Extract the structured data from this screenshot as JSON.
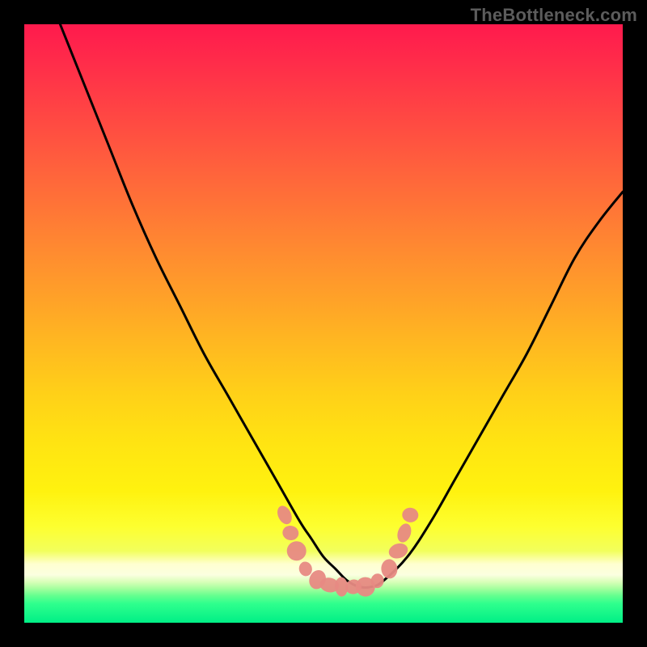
{
  "watermark": "TheBottleneck.com",
  "chart_data": {
    "type": "line",
    "title": "",
    "xlabel": "",
    "ylabel": "",
    "xlim": [
      0,
      100
    ],
    "ylim": [
      0,
      100
    ],
    "grid": false,
    "series": [
      {
        "name": "v-curve",
        "color": "#000000",
        "x": [
          6,
          10,
          14,
          18,
          22,
          26,
          30,
          34,
          38,
          42,
          46,
          48,
          50,
          52,
          54,
          56,
          58,
          60,
          64,
          68,
          72,
          76,
          80,
          84,
          88,
          92,
          96,
          100
        ],
        "y": [
          100,
          90,
          80,
          70,
          61,
          53,
          45,
          38,
          31,
          24,
          17,
          14,
          11,
          9,
          7,
          6,
          6,
          7,
          11,
          17,
          24,
          31,
          38,
          45,
          53,
          61,
          67,
          72
        ]
      }
    ],
    "markers": [
      {
        "name": "bottleneck-zone",
        "color": "#e78a83",
        "points": [
          {
            "x": 43.5,
            "y": 18
          },
          {
            "x": 44.5,
            "y": 15
          },
          {
            "x": 45.5,
            "y": 12
          },
          {
            "x": 47,
            "y": 9
          },
          {
            "x": 49,
            "y": 7.2
          },
          {
            "x": 51,
            "y": 6.3
          },
          {
            "x": 53,
            "y": 6.0
          },
          {
            "x": 55,
            "y": 6.0
          },
          {
            "x": 57,
            "y": 6.0
          },
          {
            "x": 59,
            "y": 7.0
          },
          {
            "x": 61,
            "y": 9.0
          },
          {
            "x": 62.5,
            "y": 12
          },
          {
            "x": 63.5,
            "y": 15
          },
          {
            "x": 64.5,
            "y": 18
          }
        ]
      }
    ]
  }
}
